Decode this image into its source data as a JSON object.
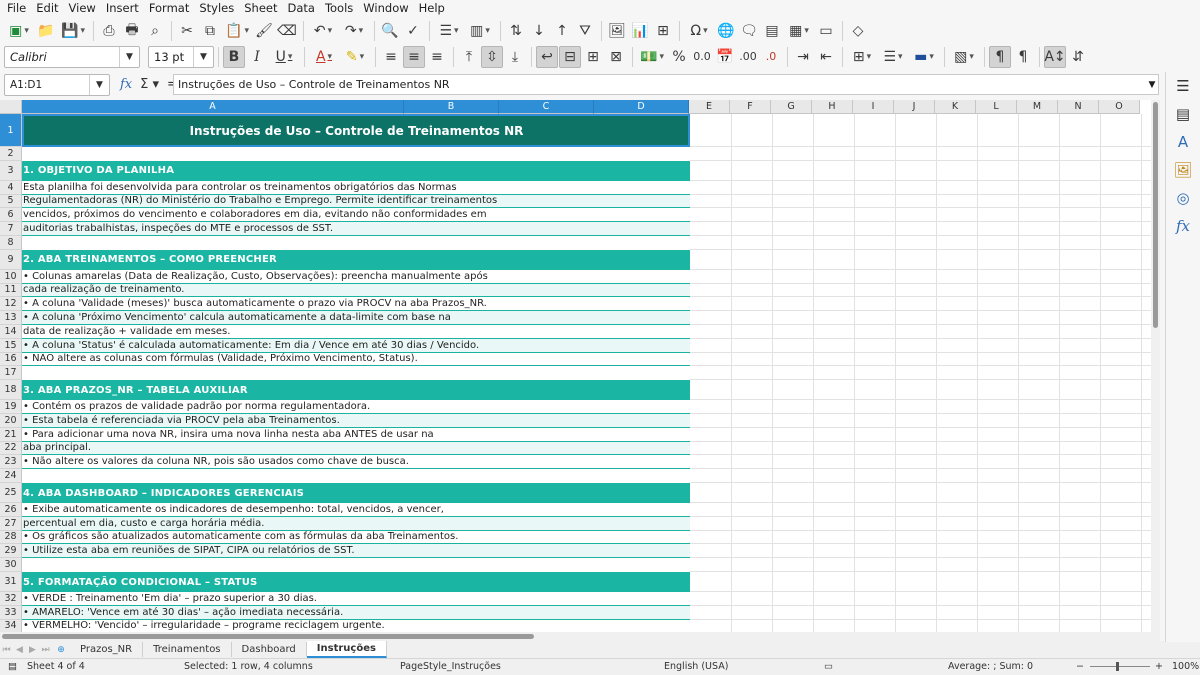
{
  "menu": [
    "File",
    "Edit",
    "View",
    "Insert",
    "Format",
    "Styles",
    "Sheet",
    "Data",
    "Tools",
    "Window",
    "Help"
  ],
  "toolbar": {
    "font_name": "Calibri",
    "font_size": "13 pt"
  },
  "formula_bar": {
    "name_box": "A1:D1",
    "content": "Instruções de Uso – Controle de Treinamentos NR"
  },
  "columns": [
    "A",
    "B",
    "C",
    "D",
    "E",
    "F",
    "G",
    "H",
    "I",
    "J",
    "K",
    "L",
    "M",
    "N",
    "O"
  ],
  "rows": [
    {
      "n": "1",
      "type": "title",
      "text": "Instruções de Uso – Controle de Treinamentos NR"
    },
    {
      "n": "2",
      "type": "blank",
      "text": ""
    },
    {
      "n": "3",
      "type": "section",
      "text": "1. OBJETIVO DA PLANILHA"
    },
    {
      "n": "4",
      "type": "body",
      "text": "Esta planilha foi desenvolvida para controlar os treinamentos obrigatórios das Normas"
    },
    {
      "n": "5",
      "type": "body",
      "text": "Regulamentadoras (NR) do Ministério do Trabalho e Emprego. Permite identificar treinamentos"
    },
    {
      "n": "6",
      "type": "body",
      "text": "vencidos, próximos do vencimento e colaboradores em dia, evitando não conformidades em"
    },
    {
      "n": "7",
      "type": "body",
      "text": "auditorias trabalhistas, inspeções do MTE e processos de SST."
    },
    {
      "n": "8",
      "type": "blank",
      "text": ""
    },
    {
      "n": "9",
      "type": "section",
      "text": "2. ABA TREINAMENTOS – COMO PREENCHER"
    },
    {
      "n": "10",
      "type": "body",
      "text": "• Colunas amarelas (Data de Realização, Custo, Observações): preencha manualmente após"
    },
    {
      "n": "11",
      "type": "body",
      "text": "  cada realização de treinamento."
    },
    {
      "n": "12",
      "type": "body",
      "text": "• A coluna 'Validade (meses)' busca automaticamente o prazo via PROCV na aba Prazos_NR."
    },
    {
      "n": "13",
      "type": "body",
      "text": "• A coluna 'Próximo Vencimento' calcula automaticamente a data-limite com base na"
    },
    {
      "n": "14",
      "type": "body",
      "text": "  data de realização + validade em meses."
    },
    {
      "n": "15",
      "type": "body",
      "text": "• A coluna 'Status' é calculada automaticamente: Em dia / Vence em até 30 dias / Vencido."
    },
    {
      "n": "16",
      "type": "body",
      "text": "• NÃO altere as colunas com fórmulas (Validade, Próximo Vencimento, Status)."
    },
    {
      "n": "17",
      "type": "blank",
      "text": ""
    },
    {
      "n": "18",
      "type": "section",
      "text": "3. ABA PRAZOS_NR – TABELA AUXILIAR"
    },
    {
      "n": "19",
      "type": "body",
      "text": "• Contém os prazos de validade padrão por norma regulamentadora."
    },
    {
      "n": "20",
      "type": "body",
      "text": "• Esta tabela é referenciada via PROCV pela aba Treinamentos."
    },
    {
      "n": "21",
      "type": "body",
      "text": "• Para adicionar uma nova NR, insira uma nova linha nesta aba ANTES de usar na"
    },
    {
      "n": "22",
      "type": "body",
      "text": "  aba principal."
    },
    {
      "n": "23",
      "type": "body",
      "text": "• Não altere os valores da coluna NR, pois são usados como chave de busca."
    },
    {
      "n": "24",
      "type": "blank",
      "text": ""
    },
    {
      "n": "25",
      "type": "section",
      "text": "4. ABA DASHBOARD – INDICADORES GERENCIAIS"
    },
    {
      "n": "26",
      "type": "body",
      "text": "• Exibe automaticamente os indicadores de desempenho: total, vencidos, a vencer,"
    },
    {
      "n": "27",
      "type": "body",
      "text": "  percentual em dia, custo e carga horária média."
    },
    {
      "n": "28",
      "type": "body",
      "text": "• Os gráficos são atualizados automaticamente com as fórmulas da aba Treinamentos."
    },
    {
      "n": "29",
      "type": "body",
      "text": "• Utilize esta aba em reuniões de SIPAT, CIPA ou relatórios de SST."
    },
    {
      "n": "30",
      "type": "blank",
      "text": ""
    },
    {
      "n": "31",
      "type": "section",
      "text": "5. FORMATAÇÃO CONDICIONAL – STATUS"
    },
    {
      "n": "32",
      "type": "body",
      "text": "• VERDE  : Treinamento 'Em dia' – prazo superior a 30 dias."
    },
    {
      "n": "33",
      "type": "body",
      "text": "• AMARELO: 'Vence em até 30 dias' – ação imediata necessária."
    },
    {
      "n": "34",
      "type": "body",
      "text": "• VERMELHO: 'Vencido' – irregularidade – programe reciclagem urgente."
    }
  ],
  "sheet_tabs": [
    "Prazos_NR",
    "Treinamentos",
    "Dashboard",
    "Instruções"
  ],
  "active_tab": "Instruções",
  "status": {
    "sheet": "Sheet 4 of 4",
    "selection": "Selected: 1 row, 4 columns",
    "page_style": "PageStyle_Instruções",
    "language": "English (USA)",
    "summary": "Average: ; Sum: 0",
    "zoom": "100%"
  }
}
